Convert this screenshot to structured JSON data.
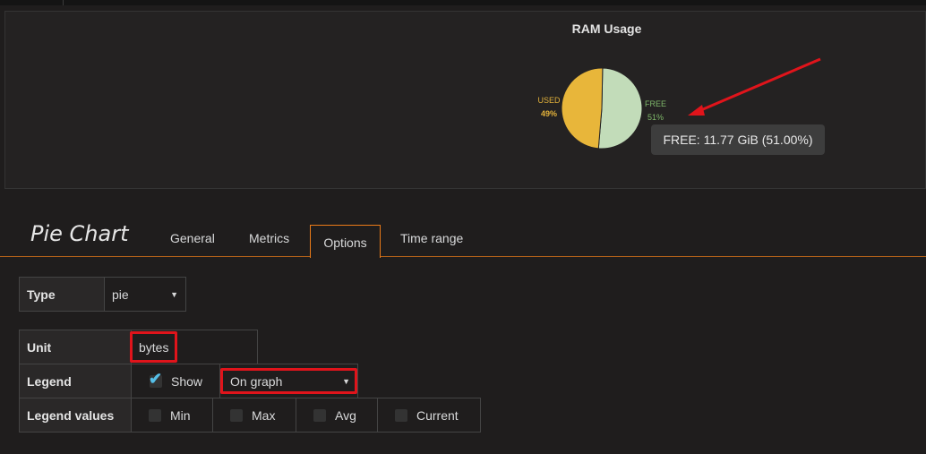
{
  "panel": {
    "title": "RAM Usage"
  },
  "chart_data": {
    "type": "pie",
    "title": "RAM Usage",
    "slices": [
      {
        "label": "USED",
        "percent_label": "49%",
        "value": 49,
        "color": "#e8b63a"
      },
      {
        "label": "FREE",
        "percent_label": "51%",
        "value": 51,
        "color": "#c2dcb9"
      }
    ],
    "tooltip": "FREE: 11.77 GiB (51.00%)",
    "colors": {
      "used": "#e8b63a",
      "free": "#c2dcb9",
      "used_text": "#e2b13a",
      "free_text": "#7fb86a",
      "annotation": "#e0141b"
    }
  },
  "editor": {
    "title": "Pie Chart",
    "tabs": [
      "General",
      "Metrics",
      "Options",
      "Time range"
    ],
    "active_tab": "Options"
  },
  "options": {
    "type_label": "Type",
    "type_value": "pie",
    "unit_label": "Unit",
    "unit_value": "bytes",
    "legend_label": "Legend",
    "legend_show_label": "Show",
    "legend_show_checked": true,
    "legend_position": "On graph",
    "legend_values_label": "Legend values",
    "legend_values": [
      {
        "label": "Min",
        "checked": false
      },
      {
        "label": "Max",
        "checked": false
      },
      {
        "label": "Avg",
        "checked": false
      },
      {
        "label": "Current",
        "checked": false
      }
    ]
  },
  "accent_color": "#eb7b18"
}
